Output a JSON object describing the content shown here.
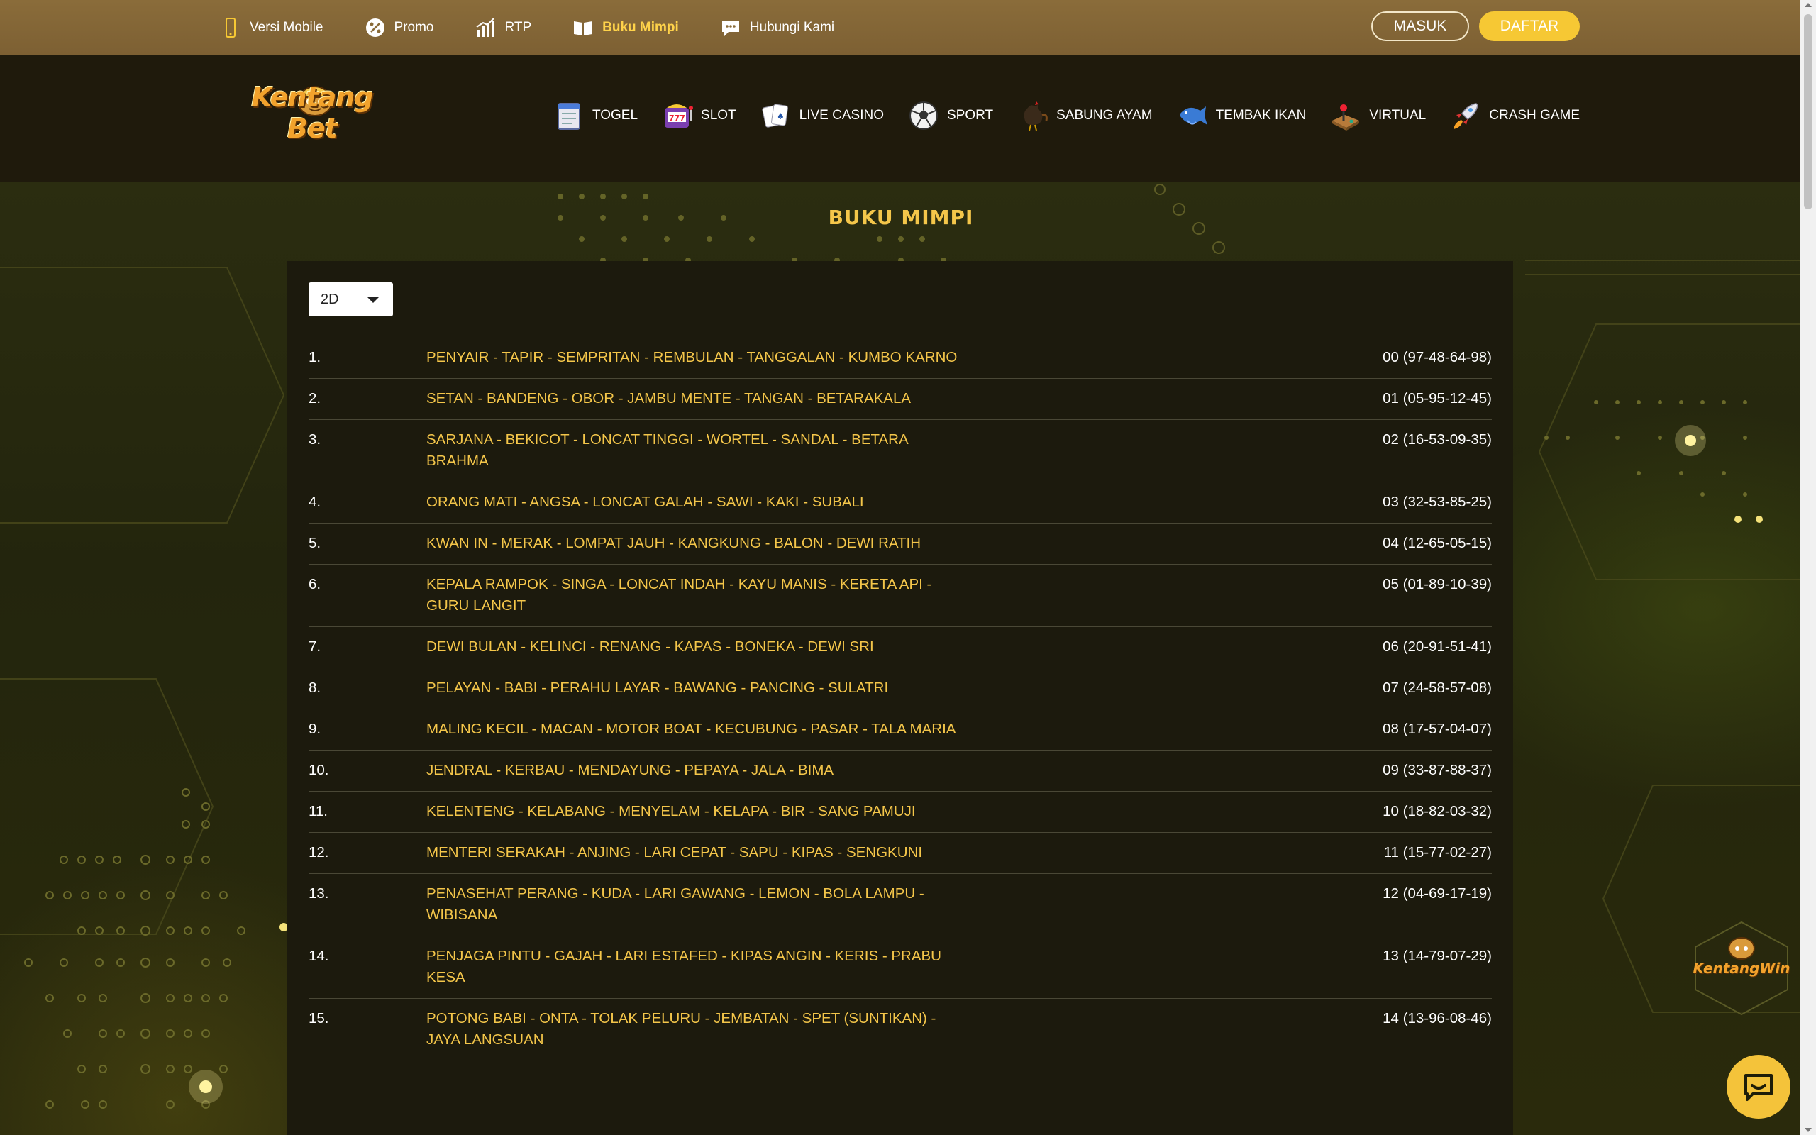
{
  "topnav": {
    "items": [
      {
        "label": "Versi Mobile",
        "icon": "mobile-phone-icon"
      },
      {
        "label": "Promo",
        "icon": "percent-badge-icon"
      },
      {
        "label": "RTP",
        "icon": "bar-chart-icon"
      },
      {
        "label": "Buku Mimpi",
        "icon": "open-book-icon",
        "active": true
      },
      {
        "label": "Hubungi Kami",
        "icon": "chat-bubble-icon"
      }
    ],
    "login_label": "MASUK",
    "register_label": "DAFTAR"
  },
  "brand": {
    "logo_text": "Kentang Bet"
  },
  "gamenav": {
    "items": [
      {
        "label": "TOGEL",
        "icon": "notepad-icon"
      },
      {
        "label": "SLOT",
        "icon": "slot-machine-icon"
      },
      {
        "label": "LIVE CASINO",
        "icon": "playing-cards-icon"
      },
      {
        "label": "SPORT",
        "icon": "soccer-ball-icon"
      },
      {
        "label": "SABUNG AYAM",
        "icon": "rooster-icon"
      },
      {
        "label": "TEMBAK IKAN",
        "icon": "fish-icon"
      },
      {
        "label": "VIRTUAL",
        "icon": "arcade-joystick-icon"
      },
      {
        "label": "CRASH GAME",
        "icon": "rocket-icon"
      }
    ]
  },
  "page": {
    "title": "BUKU MIMPI",
    "select_value": "2D"
  },
  "dream_list": [
    {
      "no": "1.",
      "words": "PENYAIR - TAPIR - SEMPRITAN - REMBULAN - TANGGALAN - KUMBO KARNO",
      "code": "00 (97-48-64-98)"
    },
    {
      "no": "2.",
      "words": "SETAN - BANDENG - OBOR - JAMBU MENTE - TANGAN - BETARAKALA",
      "code": "01 (05-95-12-45)"
    },
    {
      "no": "3.",
      "words": "SARJANA - BEKICOT - LONCAT TINGGI - WORTEL - SANDAL - BETARA BRAHMA",
      "code": "02 (16-53-09-35)"
    },
    {
      "no": "4.",
      "words": "ORANG MATI - ANGSA - LONCAT GALAH - SAWI - KAKI - SUBALI",
      "code": "03 (32-53-85-25)"
    },
    {
      "no": "5.",
      "words": "KWAN IN - MERAK - LOMPAT JAUH - KANGKUNG - BALON - DEWI RATIH",
      "code": "04 (12-65-05-15)"
    },
    {
      "no": "6.",
      "words": "KEPALA RAMPOK - SINGA - LONCAT INDAH - KAYU MANIS - KERETA API - GURU LANGIT",
      "code": "05 (01-89-10-39)"
    },
    {
      "no": "7.",
      "words": "DEWI BULAN - KELINCI - RENANG - KAPAS - BONEKA - DEWI SRI",
      "code": "06 (20-91-51-41)"
    },
    {
      "no": "8.",
      "words": "PELAYAN - BABI - PERAHU LAYAR - BAWANG - PANCING - SULATRI",
      "code": "07 (24-58-57-08)"
    },
    {
      "no": "9.",
      "words": "MALING KECIL - MACAN - MOTOR BOAT - KECUBUNG - PASAR - TALA MARIA",
      "code": "08 (17-57-04-07)"
    },
    {
      "no": "10.",
      "words": "JENDRAL - KERBAU - MENDAYUNG - PEPAYA - JALA - BIMA",
      "code": "09 (33-87-88-37)"
    },
    {
      "no": "11.",
      "words": "KELENTENG - KELABANG - MENYELAM - KELAPA - BIR - SANG PAMUJI",
      "code": "10 (18-82-03-32)"
    },
    {
      "no": "12.",
      "words": "MENTERI SERAKAH - ANJING - LARI CEPAT - SAPU - KIPAS - SENGKUNI",
      "code": "11 (15-77-02-27)"
    },
    {
      "no": "13.",
      "words": "PENASEHAT PERANG - KUDA - LARI GAWANG - LEMON - BOLA LAMPU - WIBISANA",
      "code": "12 (04-69-17-19)"
    },
    {
      "no": "14.",
      "words": "PENJAGA PINTU - GAJAH - LARI ESTAFED - KIPAS ANGIN - KERIS - PRABU KESA",
      "code": "13 (14-79-07-29)"
    },
    {
      "no": "15.",
      "words": "POTONG BABI - ONTA - TOLAK PELURU - JEMBATAN - SPET (SUNTIKAN) - JAYA LANGSUAN",
      "code": "14 (13-96-08-46)"
    }
  ],
  "floating": {
    "badge_text": "KentangWin",
    "chat_icon": "chat-support-icon"
  },
  "colors": {
    "topbar": "#8a6c3a",
    "header": "#1f1a0c",
    "accent_gold": "#f4c64a",
    "register_button": "#f6c834"
  }
}
